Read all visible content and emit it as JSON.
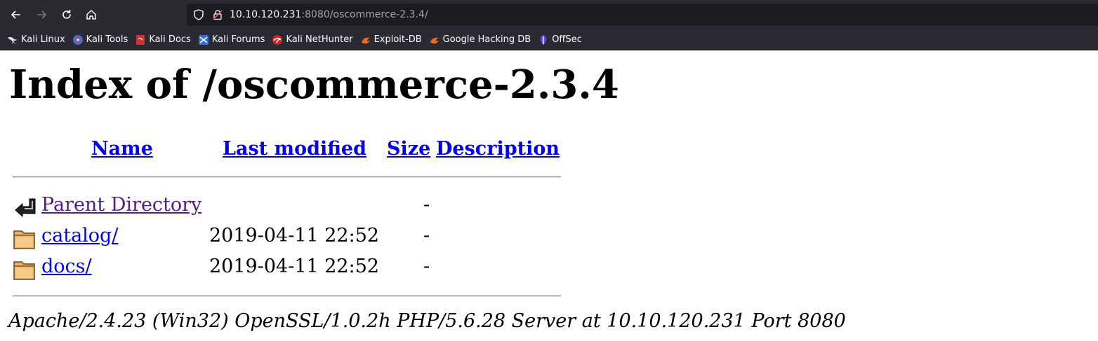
{
  "browser": {
    "url_host": "10.10.120.231",
    "url_rest": ":8080/oscommerce-2.3.4/",
    "bookmarks": [
      {
        "label": "Kali Linux",
        "icon": "kali-dragon-icon"
      },
      {
        "label": "Kali Tools",
        "icon": "kali-tools-icon"
      },
      {
        "label": "Kali Docs",
        "icon": "kali-docs-icon"
      },
      {
        "label": "Kali Forums",
        "icon": "kali-forums-icon"
      },
      {
        "label": "Kali NetHunter",
        "icon": "kali-nethunter-icon"
      },
      {
        "label": "Exploit-DB",
        "icon": "exploit-db-icon"
      },
      {
        "label": "Google Hacking DB",
        "icon": "ghdb-icon"
      },
      {
        "label": "OffSec",
        "icon": "offsec-icon"
      }
    ]
  },
  "page": {
    "title": "Index of /oscommerce-2.3.4",
    "columns": {
      "name": "Name",
      "last_modified": "Last modified",
      "size": "Size",
      "description": "Description"
    },
    "rows": [
      {
        "name": "Parent Directory",
        "modified": "",
        "size": "-",
        "icon": "back-arrow-icon",
        "visited": true
      },
      {
        "name": "catalog/",
        "modified": "2019-04-11 22:52",
        "size": "-",
        "icon": "folder-icon",
        "visited": false
      },
      {
        "name": "docs/",
        "modified": "2019-04-11 22:52",
        "size": "-",
        "icon": "folder-icon",
        "visited": false
      }
    ],
    "footer": "Apache/2.4.23 (Win32) OpenSSL/1.0.2h PHP/5.6.28 Server at 10.10.120.231 Port 8080"
  },
  "colors": {
    "link": "#0000ee",
    "visited_link": "#551a8b",
    "chrome_bg": "#2b2a33"
  }
}
